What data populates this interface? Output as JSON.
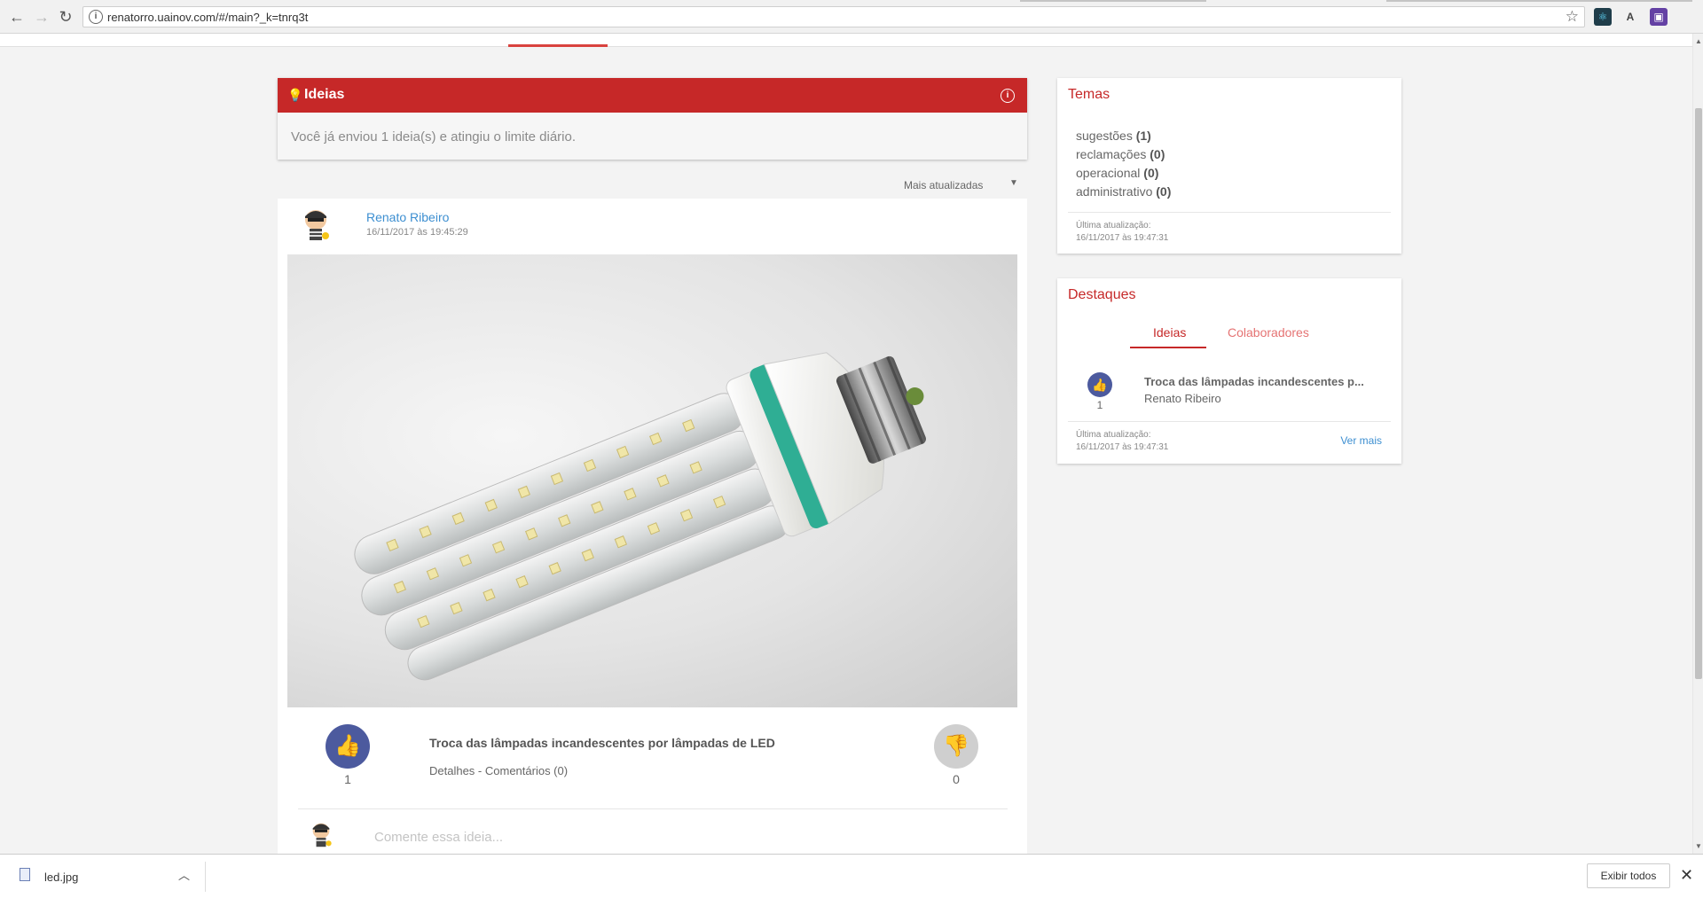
{
  "browser": {
    "url": "renatorro.uainov.com/#/main?_k=tnrq3t",
    "back_icon": "←",
    "forward_icon": "→",
    "reload_icon": "↻",
    "star_icon": "☆"
  },
  "ideias": {
    "title": "Ideias",
    "message": "Você já enviou 1 ideia(s) e atingiu o limite diário."
  },
  "sort": {
    "selected": "Mais atualizadas"
  },
  "post": {
    "author": "Renato Ribeiro",
    "date": "16/11/2017 às 19:45:29",
    "title": "Troca das lâmpadas incandescentes por lâmpadas de LED",
    "details_link": "Detalhes",
    "separator": " - ",
    "comments_link": "Comentários (0)",
    "upvotes": "1",
    "downvotes": "0",
    "comment_placeholder": "Comente essa ideia..."
  },
  "temas": {
    "title": "Temas",
    "items": [
      {
        "name": "sugestões",
        "count": "(1)"
      },
      {
        "name": "reclamações",
        "count": "(0)"
      },
      {
        "name": "operacional",
        "count": "(0)"
      },
      {
        "name": "administrativo",
        "count": "(0)"
      }
    ],
    "updated_label": "Última atualização:",
    "updated_value": "16/11/2017 às 19:47:31"
  },
  "destaques": {
    "title": "Destaques",
    "tabs": [
      "Ideias",
      "Colaboradores"
    ],
    "active_tab": "Ideias",
    "item": {
      "votes": "1",
      "title": "Troca das lâmpadas incandescentes p...",
      "author": "Renato Ribeiro"
    },
    "updated_label": "Última atualização:",
    "updated_value": "16/11/2017 às 19:47:31",
    "more_link": "Ver mais"
  },
  "downloads": {
    "file_name": "led.jpg",
    "show_all": "Exibir todos"
  },
  "colors": {
    "brand_red": "#c62828",
    "vote_blue": "#4c5a9e",
    "link_blue": "#3d8fd1"
  }
}
